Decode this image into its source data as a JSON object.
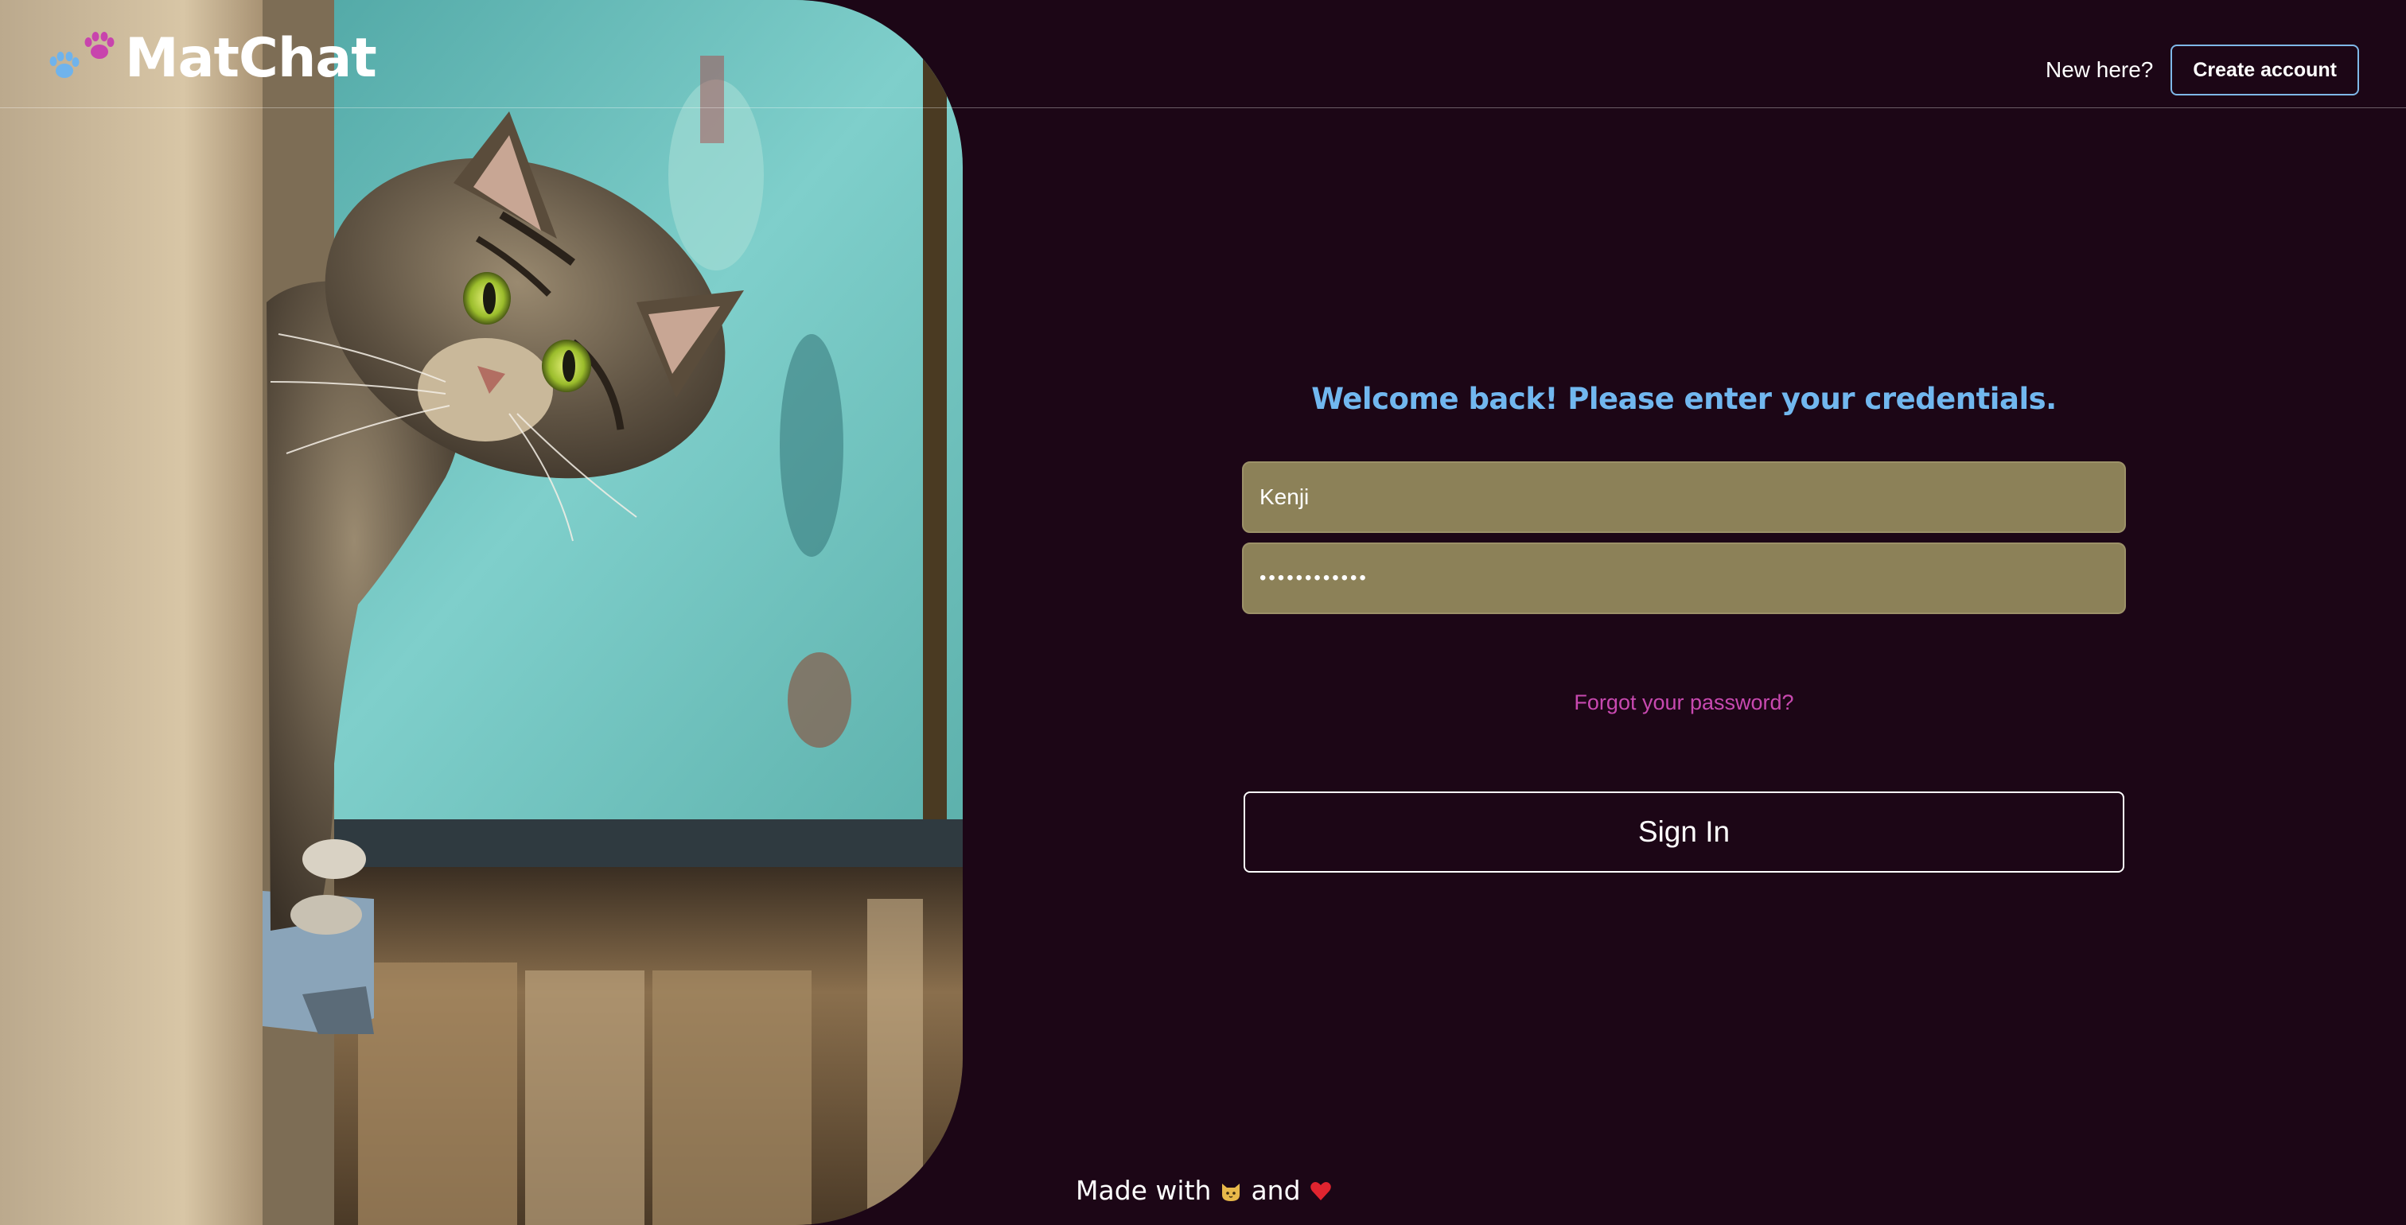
{
  "header": {
    "brand": "MatChat",
    "new_here_text": "New here?",
    "create_account_label": "Create account"
  },
  "login": {
    "title": "Welcome back! Please enter your credentials.",
    "username_value": "Kenji",
    "password_value": "••••••••••••",
    "forgot_password_label": "Forgot your password?",
    "sign_in_label": "Sign In"
  },
  "footer": {
    "made_with": "Made with",
    "and": "and",
    "cat_icon": "cat-face-icon",
    "heart_icon": "heart-icon"
  },
  "icons": {
    "logo": "paw-prints-icon"
  },
  "colors": {
    "background": "#1c0616",
    "title": "#71b7ef",
    "input_fill": "#8c8158",
    "link": "#c849b0",
    "create_border": "#7fb8e8"
  }
}
